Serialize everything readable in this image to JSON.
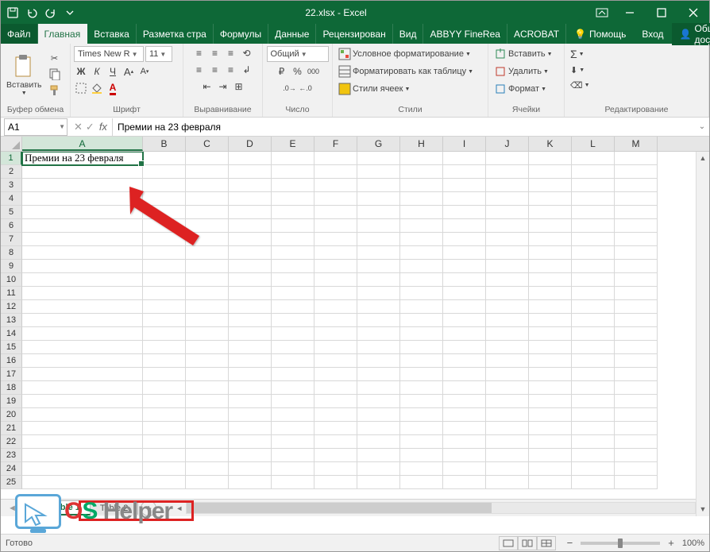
{
  "title": "22.xlsx - Excel",
  "qa": {
    "save": "save",
    "undo": "undo",
    "redo": "redo",
    "customize": "customize"
  },
  "tabs": {
    "file": "Файл",
    "items": [
      "Главная",
      "Вставка",
      "Разметка стра",
      "Формулы",
      "Данные",
      "Рецензирован",
      "Вид",
      "ABBYY FineRea",
      "ACROBAT"
    ],
    "active_index": 0,
    "help": "Помощь",
    "signin": "Вход",
    "share": "Общий доступ"
  },
  "ribbon": {
    "clipboard": {
      "paste": "Вставить",
      "label": "Буфер обмена"
    },
    "font": {
      "name": "Times New R",
      "size": "11",
      "bold": "Ж",
      "italic": "К",
      "underline": "Ч",
      "label": "Шрифт"
    },
    "alignment": {
      "label": "Выравнивание"
    },
    "number": {
      "format": "Общий",
      "label": "Число"
    },
    "styles": {
      "cond": "Условное форматирование",
      "table": "Форматировать как таблицу",
      "cell": "Стили ячеек",
      "label": "Стили"
    },
    "cells": {
      "insert": "Вставить",
      "delete": "Удалить",
      "format": "Формат",
      "label": "Ячейки"
    },
    "editing": {
      "label": "Редактирование"
    }
  },
  "namebox": "A1",
  "formula": "Премии на 23 февраля",
  "columns": [
    "A",
    "B",
    "C",
    "D",
    "E",
    "F",
    "G",
    "H",
    "I",
    "J",
    "K",
    "L",
    "M"
  ],
  "col_widths_first": 152,
  "col_width_rest": 54,
  "rows": 25,
  "cell_A1": "Премии на 23 февраля",
  "sheets": {
    "active": "Table 1",
    "other": "Table 2"
  },
  "status": "Готово",
  "zoom": "100%",
  "watermark": {
    "os": "OS",
    "helper": "Helper"
  }
}
